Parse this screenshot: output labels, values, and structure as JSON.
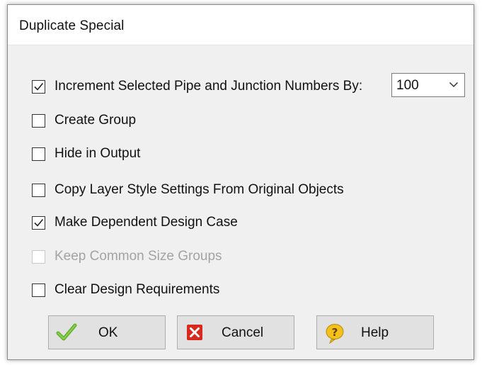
{
  "dialog": {
    "title": "Duplicate Special"
  },
  "options": [
    {
      "label": "Increment Selected Pipe and Junction Numbers By:",
      "checked": true,
      "enabled": true
    },
    {
      "label": "Create Group",
      "checked": false,
      "enabled": true
    },
    {
      "label": "Hide in Output",
      "checked": false,
      "enabled": true
    },
    {
      "label": "Copy Layer Style Settings From Original Objects",
      "checked": false,
      "enabled": true
    },
    {
      "label": "Make Dependent Design Case",
      "checked": true,
      "enabled": true
    },
    {
      "label": "Keep Common Size Groups",
      "checked": false,
      "enabled": false
    },
    {
      "label": "Clear Design Requirements",
      "checked": false,
      "enabled": true
    }
  ],
  "increment": {
    "value": "100"
  },
  "buttons": {
    "ok_label": "OK",
    "cancel_label": "Cancel",
    "help_label": "Help"
  },
  "icons": {
    "ok": "green-checkmark-icon",
    "cancel": "red-x-icon",
    "help": "help-question-icon"
  },
  "colors": {
    "dialog_bg": "#f0f0f0",
    "button_bg": "#e1e1e1",
    "ok_icon": "#5fae2e",
    "cancel_icon": "#d9281e",
    "help_icon": "#f2c21b",
    "disabled_text": "#a3a3a3"
  }
}
